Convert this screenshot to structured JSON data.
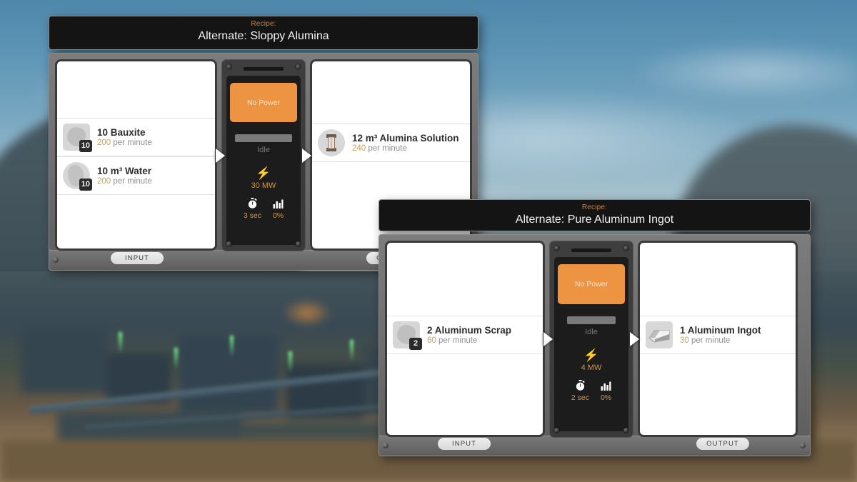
{
  "theme": {
    "accent_orange": "#ed9443",
    "recipe_label_color": "#c08a4e",
    "rate_number_color": "#c4a259",
    "machine_dark": "#1c1c1c",
    "panel_white": "#ffffff"
  },
  "dialogs": [
    {
      "id": "sloppy-alumina",
      "header": {
        "recipe_label": "Recipe:",
        "recipe_name": "Alternate: Sloppy Alumina"
      },
      "inputs": [
        {
          "name": "10 Bauxite",
          "rate_value": "200",
          "rate_suffix": " per minute",
          "badge": "10",
          "icon": "bauxite-ore-icon",
          "icon_shape": "square"
        },
        {
          "name": "10 m³ Water",
          "rate_value": "200",
          "rate_suffix": " per minute",
          "badge": "10",
          "icon": "water-fluid-icon",
          "icon_shape": "round"
        }
      ],
      "outputs": [
        {
          "name": "12 m³ Alumina Solution",
          "rate_value": "240",
          "rate_suffix": " per minute",
          "badge": "",
          "icon": "alumina-solution-fluid-icon",
          "icon_shape": "round"
        }
      ],
      "machine": {
        "power_status": "No Power",
        "progress_status": "Idle",
        "progress_percent": 0,
        "power_icon": "lightning-bolt-icon",
        "power_value": "30 MW",
        "time_icon": "stopwatch-icon",
        "time_value": "3 sec",
        "efficiency_icon": "bar-chart-icon",
        "efficiency_value": "0%"
      },
      "footer": {
        "input_tab": "INPUT",
        "output_tab": "OUTPUT"
      }
    },
    {
      "id": "pure-aluminum-ingot",
      "header": {
        "recipe_label": "Recipe:",
        "recipe_name": "Alternate: Pure Aluminum Ingot"
      },
      "inputs": [
        {
          "name": "2 Aluminum Scrap",
          "rate_value": "60",
          "rate_suffix": " per minute",
          "badge": "2",
          "icon": "aluminum-scrap-icon",
          "icon_shape": "square"
        }
      ],
      "outputs": [
        {
          "name": "1 Aluminum Ingot",
          "rate_value": "30",
          "rate_suffix": " per minute",
          "badge": "",
          "icon": "aluminum-ingot-icon",
          "icon_shape": "square"
        }
      ],
      "machine": {
        "power_status": "No Power",
        "progress_status": "Idle",
        "progress_percent": 0,
        "power_icon": "lightning-bolt-icon",
        "power_value": "4 MW",
        "time_icon": "stopwatch-icon",
        "time_value": "2 sec",
        "efficiency_icon": "bar-chart-icon",
        "efficiency_value": "0%"
      },
      "footer": {
        "input_tab": "INPUT",
        "output_tab": "OUTPUT"
      }
    }
  ]
}
